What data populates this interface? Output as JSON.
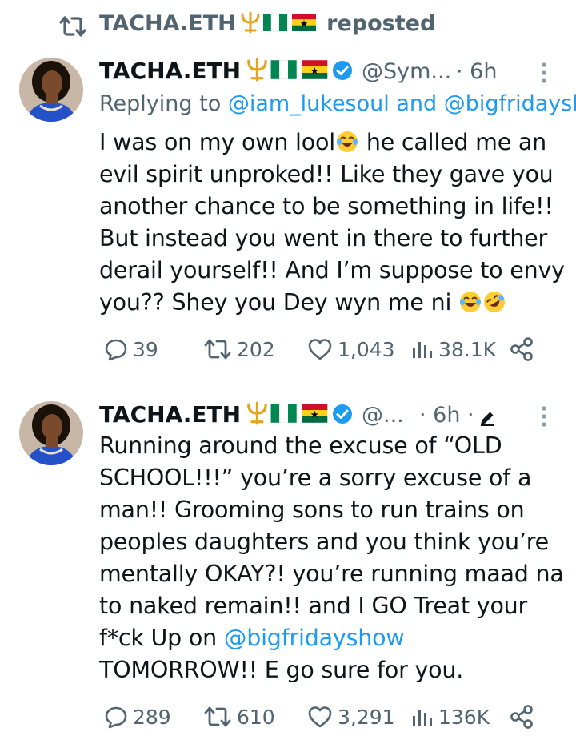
{
  "repost": {
    "label": "TACHA.ETH🔱🇳🇬🇬🇭 reposted",
    "name": "TACHA.ETH",
    "suffix": "reposted"
  },
  "tweets": [
    {
      "name": "TACHA.ETH",
      "handle": "@Sym...",
      "time": "· 6h",
      "reply_prefix": "Replying to",
      "reply_mentions": "@iam_lukesoul and @bigfridaysh",
      "text_lines": [
        "I was on my own lool",
        " he called me an",
        "evil spirit unproked!! Like they gave you",
        "another chance to be something in life!!",
        "But instead you went in there to further",
        "derail yourself!! And I’m suppose to envy",
        "you?? Shey you Dey wyn me ni "
      ],
      "stats": {
        "replies": "39",
        "reposts": "202",
        "likes": "1,043",
        "views": "38.1K"
      }
    },
    {
      "name": "TACHA.ETH",
      "handle": "@...",
      "time": "· 6h ·",
      "text_lines": [
        "Running around the excuse of “OLD",
        "SCHOOL!!!” you’re a sorry excuse of a",
        "man!! Grooming sons to run trains on",
        "peoples daughters and you think you’re",
        "mentally OKAY?! you’re running maad na",
        "to naked remain!! and I GO Treat your",
        "f*ck Up on ",
        "TOMORROW!! E go sure for you."
      ],
      "mention": "@bigfridayshow",
      "stats": {
        "replies": "289",
        "reposts": "610",
        "likes": "3,291",
        "views": "136K"
      }
    }
  ],
  "colors": {
    "text": "#0f1419",
    "secondary": "#536471",
    "link": "#1d9bf0",
    "verified": "#1d9bf0"
  },
  "icons": [
    "repost-icon",
    "trident-icon",
    "nigeria-flag-icon",
    "ghana-flag-icon",
    "verified-badge-icon",
    "more-icon",
    "reply-icon",
    "retweet-icon",
    "like-icon",
    "views-icon",
    "share-icon",
    "edit-icon",
    "laughing-emoji-icon",
    "rofl-emoji-icon"
  ]
}
